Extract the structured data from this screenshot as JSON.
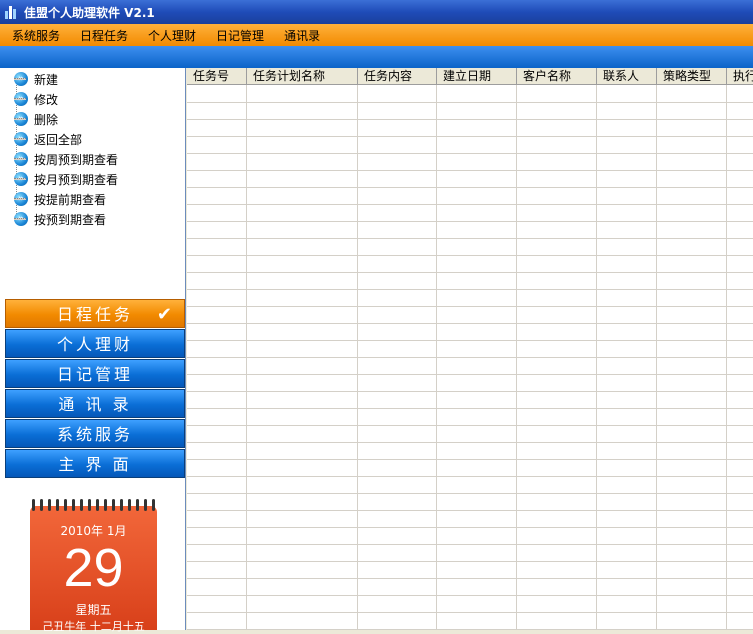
{
  "window": {
    "title": "佳盟个人助理软件 V2.1"
  },
  "menu": [
    "系统服务",
    "日程任务",
    "个人理财",
    "日记管理",
    "通讯录"
  ],
  "tree": [
    "新建",
    "修改",
    "删除",
    "返回全部",
    "按周预到期查看",
    "按月预到期查看",
    "按提前期查看",
    "按预到期查看"
  ],
  "nav": [
    {
      "label": "日程任务",
      "active": true
    },
    {
      "label": "个人理财",
      "active": false
    },
    {
      "label": "日记管理",
      "active": false
    },
    {
      "label": "通 讯 录",
      "active": false
    },
    {
      "label": "系统服务",
      "active": false
    },
    {
      "label": "主 界 面",
      "active": false
    }
  ],
  "calendar": {
    "year_month": "2010年 1月",
    "day": "29",
    "weekday": "星期五",
    "lunar": "己丑牛年 十二月十五"
  },
  "table": {
    "columns": [
      "任务号",
      "任务计划名称",
      "任务内容",
      "建立日期",
      "客户名称",
      "联系人",
      "策略类型",
      "执行"
    ]
  },
  "colors": {
    "menu": "#f28a00",
    "nav": "#0a6ed6",
    "active_nav": "#f28a00"
  }
}
